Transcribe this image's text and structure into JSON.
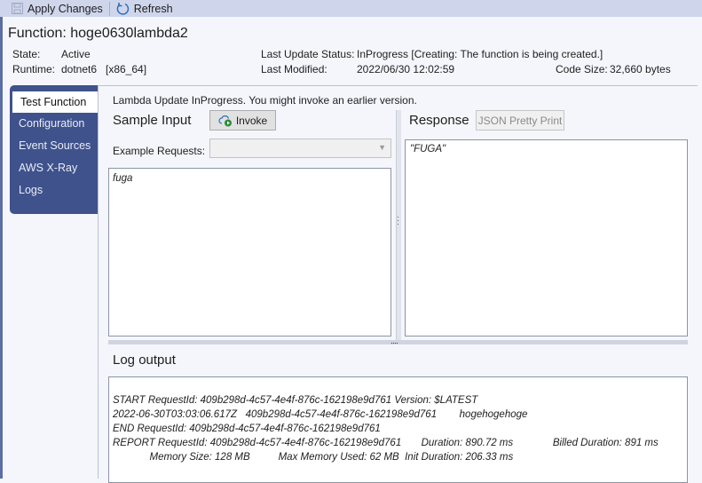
{
  "toolbar": {
    "apply_label": "Apply Changes",
    "refresh_label": "Refresh"
  },
  "header": {
    "title": "Function: hoge0630lambda2",
    "state_label": "State:",
    "state_value": "Active",
    "runtime_label": "Runtime:",
    "runtime_value": "dotnet6",
    "arch_value": "[x86_64]",
    "status_label": "Last Update Status:",
    "status_value": "InProgress [Creating: The function is being created.]",
    "modified_label": "Last Modified:",
    "modified_value": "2022/06/30 12:02:59",
    "codesize_label": "Code Size:",
    "codesize_value": "32,660 bytes"
  },
  "sidebar": {
    "items": [
      {
        "label": "Test Function"
      },
      {
        "label": "Configuration"
      },
      {
        "label": "Event Sources"
      },
      {
        "label": "AWS X-Ray"
      },
      {
        "label": "Logs"
      }
    ]
  },
  "main": {
    "notice": "Lambda Update InProgress. You might invoke an earlier version.",
    "sample_input_label": "Sample Input",
    "invoke_label": "Invoke",
    "example_requests_label": "Example Requests:",
    "example_requests_value": "",
    "input_value": "fuga",
    "response_label": "Response",
    "pretty_print_label": "JSON Pretty Print",
    "response_value": "\"FUGA\"",
    "log_label": "Log output",
    "log_lines": [
      "START RequestId: 409b298d-4c57-4e4f-876c-162198e9d761 Version: $LATEST",
      "2022-06-30T03:03:06.617Z   409b298d-4c57-4e4f-876c-162198e9d761        hogehogehoge",
      "END RequestId: 409b298d-4c57-4e4f-876c-162198e9d761",
      "REPORT RequestId: 409b298d-4c57-4e4f-876c-162198e9d761       Duration: 890.72 ms              Billed Duration: 891 ms",
      "             Memory Size: 128 MB          Max Memory Used: 62 MB  Init Duration: 206.33 ms"
    ]
  }
}
